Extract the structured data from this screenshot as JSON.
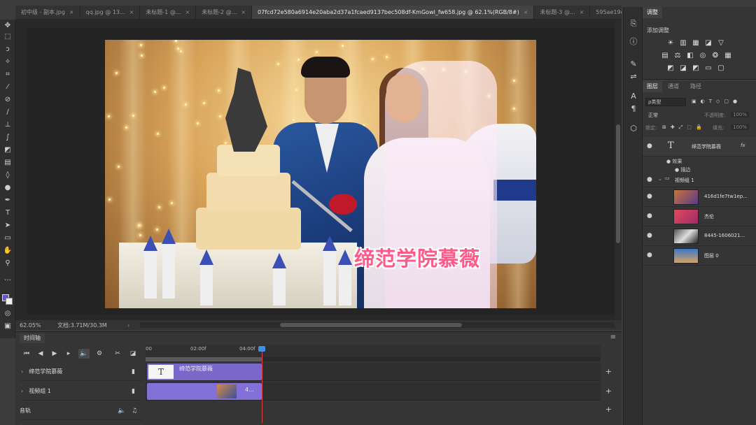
{
  "tabs": [
    {
      "label": "初中级 - 副本.jpg",
      "active": false
    },
    {
      "label": "qq.jpg @ 13...",
      "active": false
    },
    {
      "label": "未标题-1 @...",
      "active": false
    },
    {
      "label": "未标题-2 @...",
      "active": false
    },
    {
      "label": "07fcd72e580a6914e20aba2d37a1fcaed9137bec508df-KmGowl_fw658.jpg @ 62.1%(RGB/8#)",
      "active": true
    },
    {
      "label": "未标题-3 @...",
      "active": false
    },
    {
      "label": "595ae19ce74",
      "active": false
    }
  ],
  "tab_close_glyph": "×",
  "canvas": {
    "overlay_text": "缔范学院慕薇"
  },
  "status": {
    "zoom": "62.05%",
    "doc": "文档:3.71M/30.3M",
    "arrow": "›"
  },
  "timeline": {
    "title": "时间轴",
    "ruler": [
      "00",
      "02:00f",
      "04:00f"
    ],
    "tracks": [
      {
        "label": "缔范学院慕薇",
        "clip_name": "缔范学院慕薇",
        "thumb_glyph": "T"
      },
      {
        "label": "视频组 1",
        "clip_name": "4..."
      },
      {
        "label": "音轨"
      }
    ],
    "plus": "+"
  },
  "adjustments": {
    "tab": "调整",
    "sub_label": "添加调整"
  },
  "layers_panel": {
    "tabs": [
      "图层",
      "通道",
      "路径"
    ],
    "filter_kind": "ρ类型",
    "blend_mode": "正常",
    "opacity_label": "不透明度:",
    "opacity_value": "100%",
    "lock_label": "锁定:",
    "fill_label": "填充:",
    "fill_value": "100%",
    "layers": [
      {
        "name": "缔范学院慕薇",
        "kind": "text",
        "fx": "fx"
      },
      {
        "name": "效果",
        "kind": "effect"
      },
      {
        "name": "描边",
        "kind": "effect-item"
      },
      {
        "name": "视频组 1",
        "kind": "group"
      },
      {
        "name": "416d1fe7tw1ep...",
        "kind": "image"
      },
      {
        "name": "杰伦",
        "kind": "image"
      },
      {
        "name": "8445-1606021...",
        "kind": "image"
      },
      {
        "name": "图层 0",
        "kind": "image"
      }
    ]
  },
  "colors": {
    "foreground": "#6a4fd1",
    "overlay_text": "#ff5a8a",
    "clip": "#7a68c9",
    "playhead": "#e04040"
  }
}
